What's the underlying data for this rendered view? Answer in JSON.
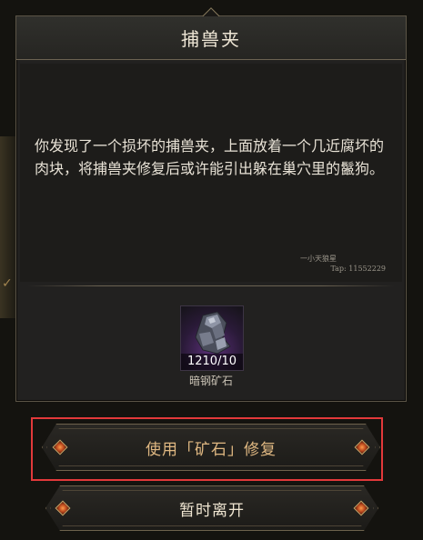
{
  "dialog": {
    "title": "捕兽夹",
    "story": "你发现了一个损坏的捕兽夹，上面放着一个几近腐坏的肉块，将捕兽夹修复后或许能引出躲在巢穴里的鬣狗。",
    "watermark_name": "一小天狼星",
    "watermark_tap": "Tap: 11552229"
  },
  "item": {
    "icon": "ore-icon",
    "quantity": "1210/10",
    "name": "暗钢矿石"
  },
  "buttons": {
    "repair_label": "使用「矿石」修复",
    "leave_label": "暂时离开"
  },
  "colors": {
    "accent": "#e0b882",
    "highlight": "#e2393a",
    "gem": "#ff9a4a"
  }
}
